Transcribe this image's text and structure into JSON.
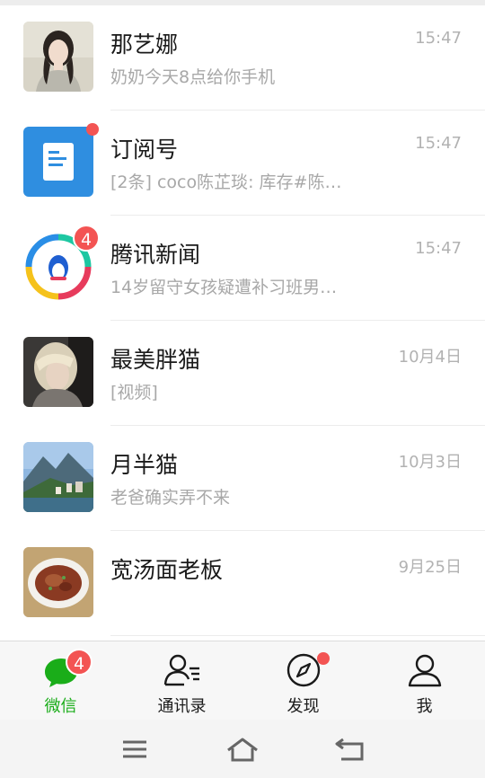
{
  "chats": [
    {
      "name": "那艺娜",
      "preview": "奶奶今天8点给你手机",
      "time": "15:47"
    },
    {
      "name": "订阅号",
      "preview": "[2条] coco陈芷琰: 库存#陈…",
      "time": "15:47",
      "unread_dot": true
    },
    {
      "name": "腾讯新闻",
      "preview": "14岁留守女孩疑遭补习班男…",
      "time": "15:47",
      "badge": "4"
    },
    {
      "name": "最美胖猫",
      "preview": "[视频]",
      "time": "10月4日"
    },
    {
      "name": "月半猫",
      "preview": "老爸确实弄不来",
      "time": "10月3日"
    },
    {
      "name": "宽汤面老板",
      "preview": "",
      "time": "9月25日"
    }
  ],
  "tabs": [
    {
      "label": "微信",
      "icon": "chat-bubble-icon",
      "active": true,
      "badge": "4"
    },
    {
      "label": "通讯录",
      "icon": "contacts-icon"
    },
    {
      "label": "发现",
      "icon": "compass-icon",
      "unread_dot": true
    },
    {
      "label": "我",
      "icon": "person-icon"
    }
  ],
  "system_nav": [
    "menu-icon",
    "home-icon",
    "back-icon"
  ],
  "colors": {
    "accent": "#1aad19",
    "badge": "#f35453",
    "preview_text": "#a8a8a8"
  }
}
